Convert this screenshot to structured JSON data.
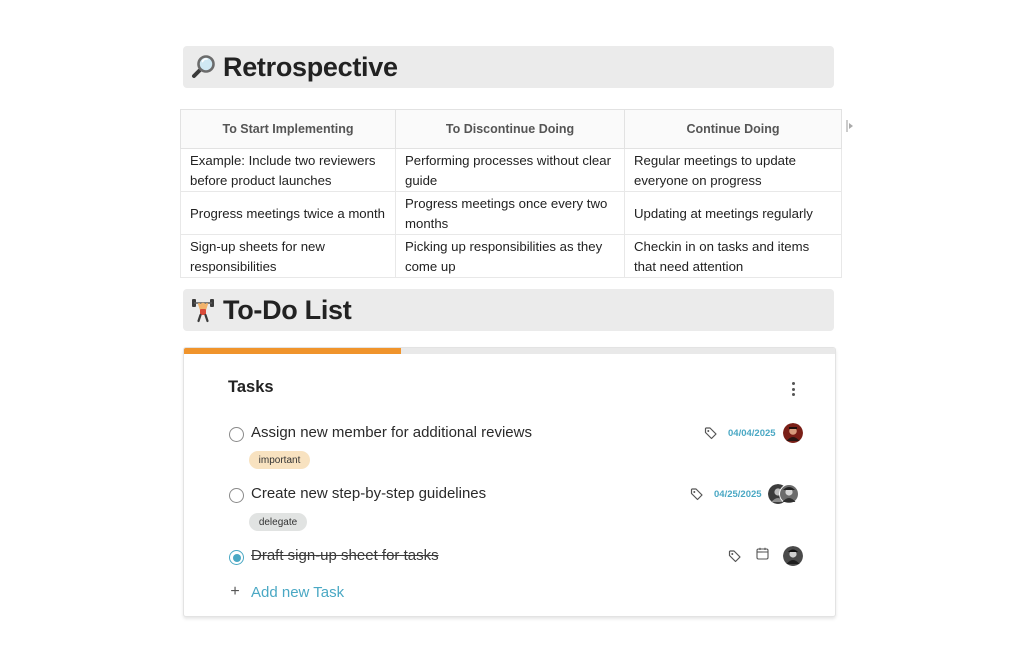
{
  "retrospective": {
    "title": "Retrospective",
    "icon": "magnifying-glass-icon",
    "columns": [
      "To Start Implementing",
      "To Discontinue Doing",
      "Continue Doing"
    ],
    "rows": [
      [
        "Example: Include two reviewers before product launches",
        "Performing processes without clear guide",
        "Regular meetings to update everyone on progress"
      ],
      [
        "Progress meetings twice a month",
        "Progress meetings once every two months",
        "Updating at meetings regularly"
      ],
      [
        "Sign-up sheets for new responsibilities",
        "Picking up responsibilities as they come up",
        "Checkin in on tasks and items that need attention"
      ]
    ]
  },
  "todo": {
    "title": "To-Do List",
    "icon": "weightlifter-icon",
    "card": {
      "title": "Tasks",
      "progress": 0.333,
      "progress_color": "#f0942c",
      "add_label": "Add new Task",
      "tasks": [
        {
          "label": "Assign new member for additional reviews",
          "done": false,
          "tag": "important",
          "tag_color": "#f8e2c0",
          "date": "04/04/2025"
        },
        {
          "label": "Create new step-by-step guidelines",
          "done": false,
          "tag": "delegate",
          "tag_color": "#e1e3e2",
          "date": "04/25/2025"
        },
        {
          "label": "Draft sign-up sheet for tasks",
          "done": true,
          "tag": "",
          "date": ""
        }
      ]
    }
  },
  "colors": {
    "accent": "#4aa8c4",
    "heading_bg": "#ebebeb"
  }
}
